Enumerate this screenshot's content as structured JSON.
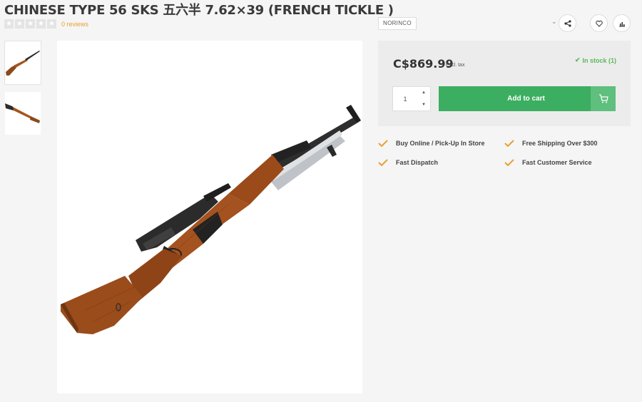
{
  "product": {
    "title": "CHINESE TYPE 56 SKS 五六半 7.62×39 (FRENCH TICKLE )",
    "rating": {
      "stars": 0,
      "max": 5,
      "reviews_label": "0 reviews"
    },
    "brand": "NORINCO",
    "price": "C$869.99",
    "tax_note": "Excl. tax",
    "stock_status": "In stock (1)",
    "quantity": "1",
    "add_to_cart_label": "Add to cart",
    "image_description": "rifle"
  },
  "actions": {
    "share_icon": "share-icon",
    "wishlist_icon": "heart-icon",
    "compare_icon": "chart-icon"
  },
  "features": [
    {
      "label": "Buy Online / Pick-Up In Store"
    },
    {
      "label": "Free Shipping Over $300"
    },
    {
      "label": "Fast Dispatch"
    },
    {
      "label": "Fast Customer Service"
    }
  ],
  "colors": {
    "accent_green": "#3cae61",
    "stock_green": "#5cb85c",
    "check_orange": "#e8a033",
    "review_orange": "#e8a033"
  }
}
